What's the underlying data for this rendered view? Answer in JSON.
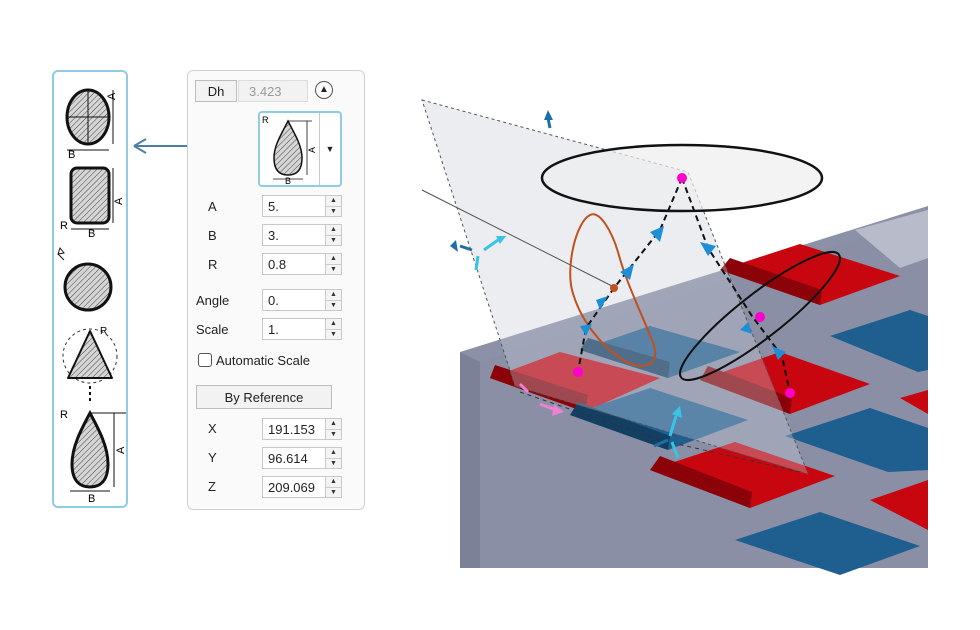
{
  "palette": {
    "shapes": [
      {
        "name": "ellipse",
        "labels": [
          "A",
          "B"
        ]
      },
      {
        "name": "rounded-rectangle",
        "labels": [
          "A",
          "B",
          "R"
        ]
      },
      {
        "name": "circle"
      },
      {
        "name": "triangle",
        "labels": [
          "R"
        ]
      },
      {
        "name": "teardrop",
        "labels": [
          "A",
          "B",
          "R"
        ]
      }
    ]
  },
  "panel": {
    "dh_label": "Dh",
    "dh_value": "3.423",
    "collapse_icon": "chevron-up-circle",
    "preview_labels": {
      "a": "A",
      "b": "B",
      "r": "R"
    },
    "fields": [
      {
        "label": "A",
        "value": "5."
      },
      {
        "label": "B",
        "value": "3."
      },
      {
        "label": "R",
        "value": "0.8"
      },
      {
        "label": "Angle",
        "value": "0."
      },
      {
        "label": "Scale",
        "value": "1."
      }
    ],
    "automatic_scale": {
      "label": "Automatic Scale",
      "checked": false
    },
    "by_reference_label": "By Reference",
    "coords": [
      {
        "label": "X",
        "value": "191.153"
      },
      {
        "label": "Y",
        "value": "96.614"
      },
      {
        "label": "Z",
        "value": "209.069"
      }
    ]
  },
  "colors": {
    "accent": "#8fcbe3",
    "cell_red": "#d10a12",
    "cell_blue": "#1f5f8f",
    "body": "#8a8fa6",
    "handle_blue": "#1e90d6",
    "point_magenta": "#ff00cc",
    "profile_orange": "#c0501e"
  }
}
